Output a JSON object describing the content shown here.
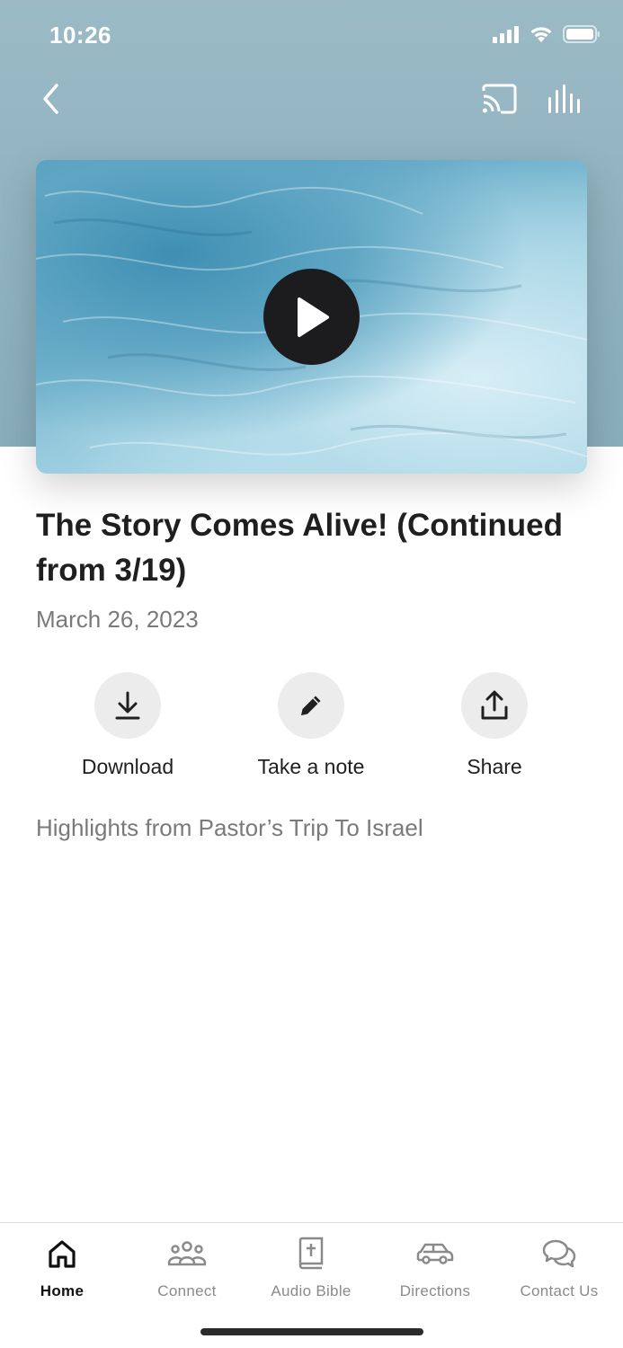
{
  "status_bar": {
    "time": "10:26"
  },
  "nav": {
    "back_icon": "chevron-left-icon",
    "cast_icon": "cast-icon",
    "audio_icon": "audio-bars-icon"
  },
  "media": {
    "play_icon": "play-icon"
  },
  "sermon": {
    "title": "The Story Comes Alive! (Continued from 3/19)",
    "date": "March 26, 2023",
    "description": "Highlights from Pastor’s Trip To Israel"
  },
  "actions": [
    {
      "label": "Download",
      "icon": "download-icon"
    },
    {
      "label": "Take a note",
      "icon": "pencil-icon"
    },
    {
      "label": "Share",
      "icon": "share-icon"
    }
  ],
  "tabs": [
    {
      "label": "Home",
      "icon": "home-icon",
      "active": true
    },
    {
      "label": "Connect",
      "icon": "people-icon",
      "active": false
    },
    {
      "label": "Audio Bible",
      "icon": "bible-icon",
      "active": false
    },
    {
      "label": "Directions",
      "icon": "car-icon",
      "active": false
    },
    {
      "label": "Contact Us",
      "icon": "chat-icon",
      "active": false
    }
  ],
  "colors": {
    "header_bg": "#9bbac6",
    "active_tab": "#111111",
    "inactive_tab": "#8a8a8a",
    "action_circle": "#ececec"
  }
}
